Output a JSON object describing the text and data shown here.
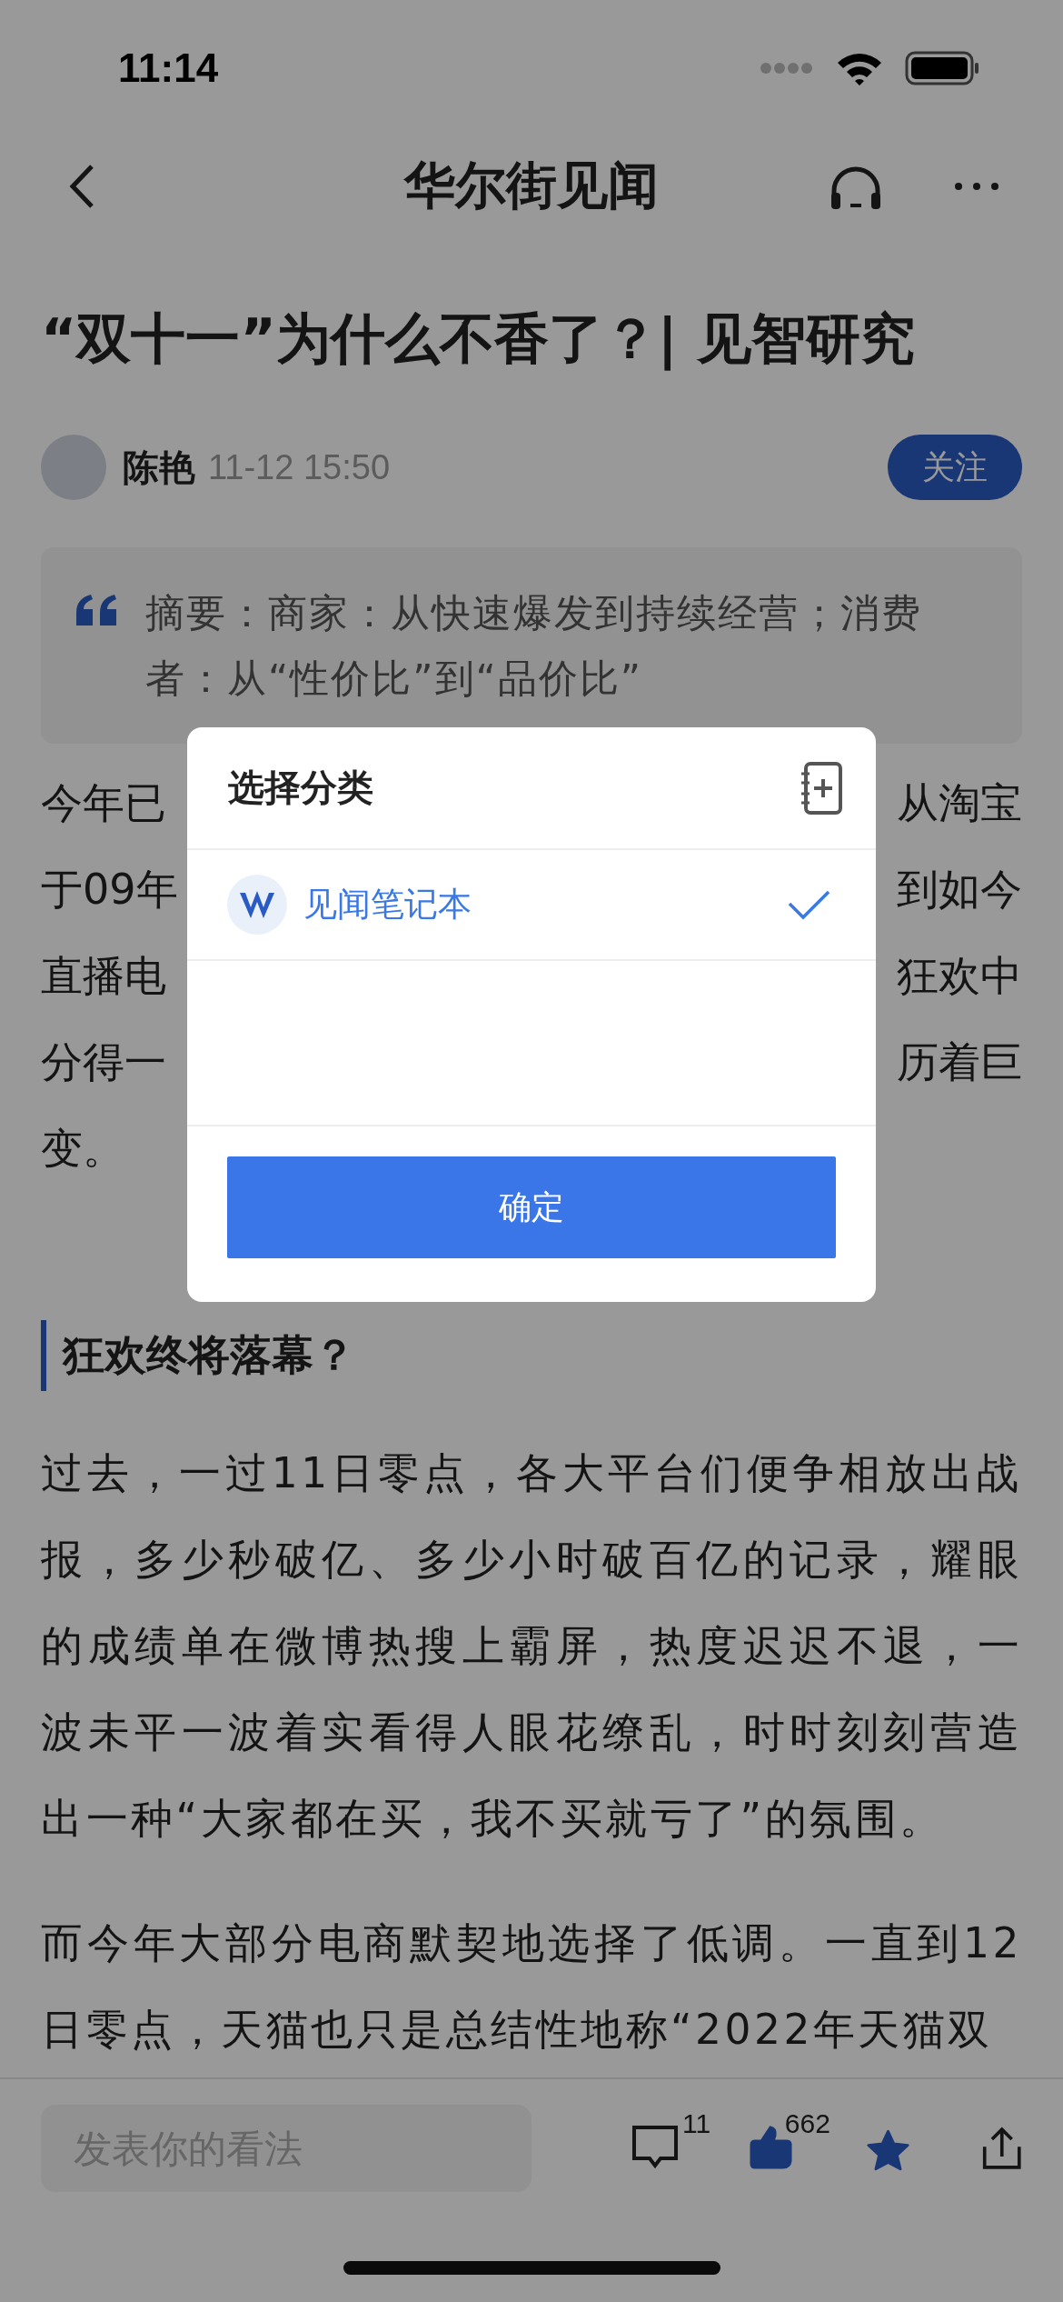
{
  "status_bar": {
    "time": "11:14"
  },
  "nav": {
    "title": "华尔街见闻"
  },
  "article": {
    "title": "“双十一”为什么不香了？| 见智研究",
    "author": "陈艳",
    "time": "11-12 15:50",
    "follow": "关注",
    "summary": "摘要：商家：从快速爆发到持续经营；消费者：从“性价比”到“品价比”",
    "covered_lines": [
      {
        "left": "今年已",
        "right": "从淘宝"
      },
      {
        "left": "于09年",
        "right": "到如今"
      },
      {
        "left": "直播电",
        "right": "狂欢中"
      },
      {
        "left": "分得一",
        "right": "历着巨"
      },
      {
        "left": "变。"
      }
    ],
    "heading": "狂欢终将落幕？",
    "paragraphs": [
      "过去，一过11日零点，各大平台们便争相放出战报，多少秒破亿、多少小时破百亿的记录，耀眼的成绩单在微博热搜上霸屏，热度迟迟不退，一波未平一波着实看得人眼花缭乱，时时刻刻营造出一种“大家都在买，我不买就亏了”的氛围。",
      "而今年大部分电商默契地选择了低调。一直到12日零点，天猫也只是总结性地称“2022年天猫双"
    ]
  },
  "dialog": {
    "title": "选择分类",
    "items": [
      {
        "name": "见闻笔记本",
        "selected": true
      }
    ],
    "confirm": "确定"
  },
  "bottom_bar": {
    "placeholder": "发表你的看法",
    "comments": "11",
    "likes": "662",
    "liked": true,
    "favorited": true
  }
}
